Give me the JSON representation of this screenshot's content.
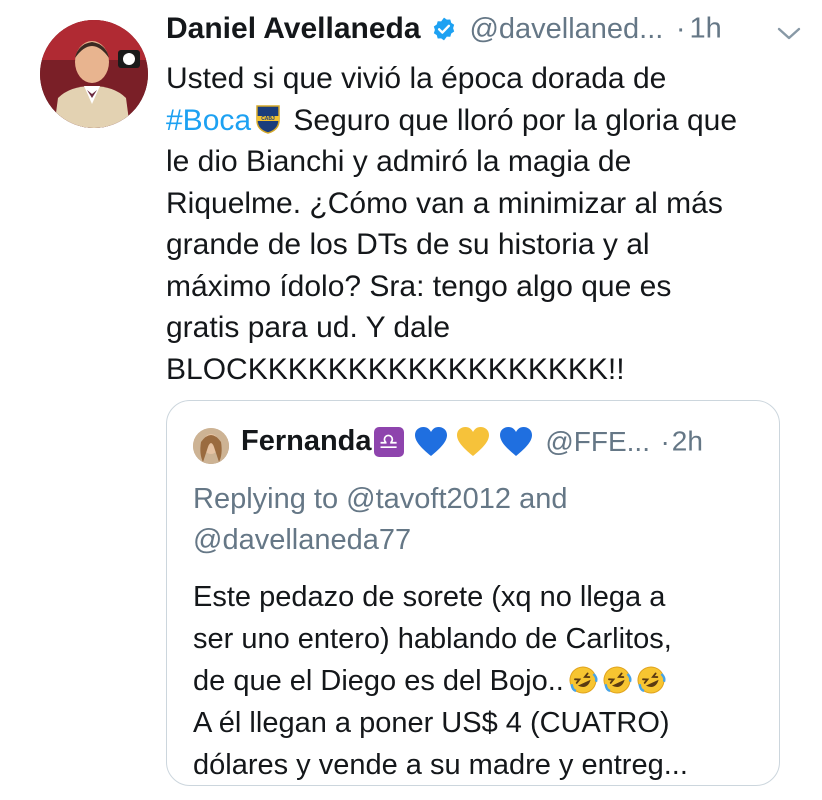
{
  "tweet": {
    "author_name": "Daniel Avellaneda",
    "handle": "@davellaned...",
    "separator": "·",
    "time": "1h",
    "text_lines": [
      "Usted si que vivió la época dorada de",
      "Seguro que lloró por la gloria que",
      "le dio Bianchi y admiró la magia de",
      "Riquelme. ¿Cómo van a minimizar al más",
      "grande de los DTs de su historia y al",
      "máximo ídolo? Sra: tengo algo que es",
      "gratis para ud. Y dale",
      "BLOCKKKKKKKKKKKKKKKKKK!!"
    ],
    "hashtag": "#Boca",
    "hashtag_color": "#1da1f2",
    "icons": [
      "verified-badge-icon",
      "boca-crest-emoji",
      "chevron-down-icon"
    ]
  },
  "quoted_tweet": {
    "author_name": "Fernanda",
    "emoji": [
      "libra-emoji",
      "blue-heart-emoji",
      "yellow-heart-emoji",
      "blue-heart-emoji"
    ],
    "libra_symbol": "♎",
    "handle": "@FFE...",
    "separator": "·",
    "time": "2h",
    "replying_lines": [
      "Replying to @tavoft2012 and",
      "@davellaneda77"
    ],
    "text_lines": [
      "Este pedazo de sorete (xq no llega a",
      "ser uno entero) hablando de Carlitos,",
      "de que el Diego es del Bojo..",
      "A él llegan a poner US$ 4 (CUATRO)",
      "dólares y vende a su madre y entreg..."
    ],
    "emoji_after_line3": [
      "rofl-emoji",
      "rofl-emoji",
      "rofl-emoji"
    ]
  },
  "colors": {
    "text": "#14171a",
    "secondary": "#657786",
    "link": "#1da1f2",
    "border": "#ccd6dd"
  }
}
